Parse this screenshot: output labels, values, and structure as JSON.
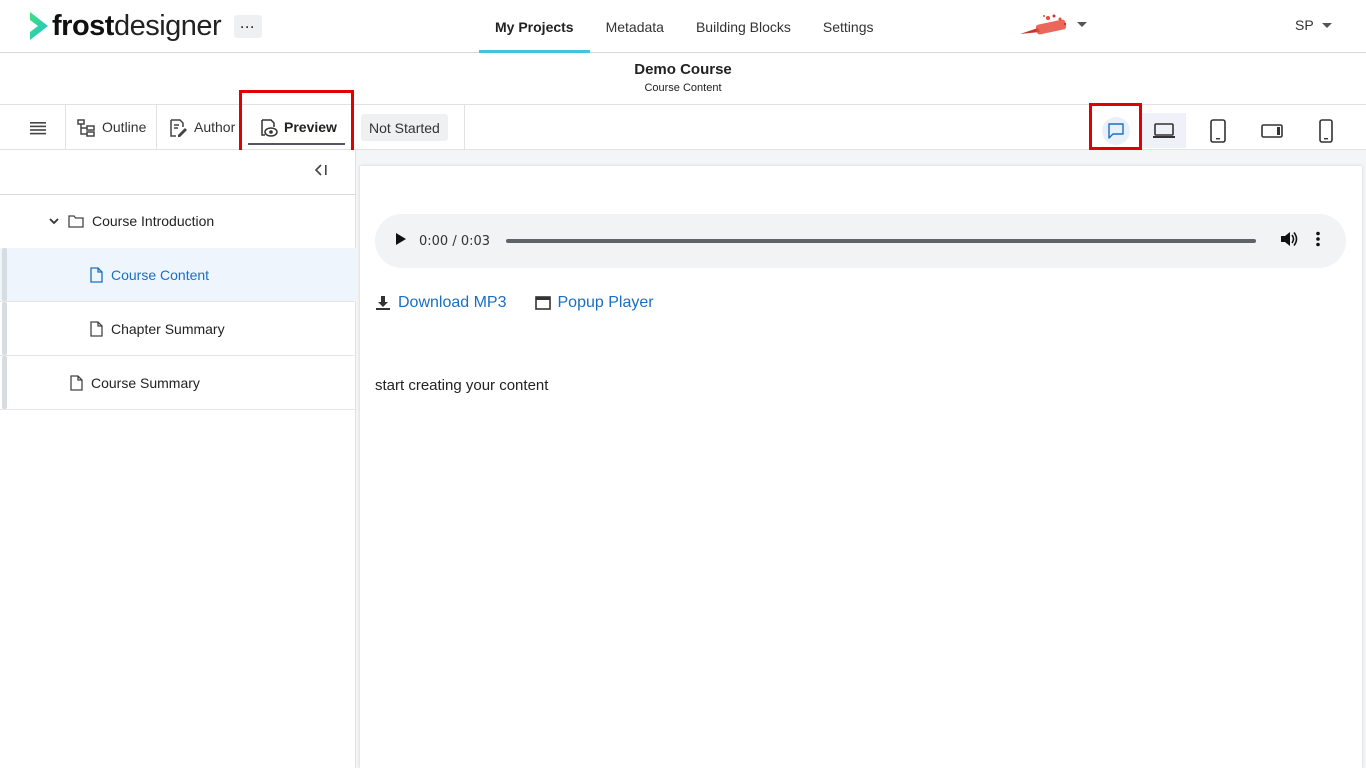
{
  "app": {
    "logo_bold": "frost",
    "logo_light": "designer"
  },
  "header": {
    "more_label": "···",
    "nav": [
      {
        "label": "My Projects",
        "active": true
      },
      {
        "label": "Metadata"
      },
      {
        "label": "Building Blocks"
      },
      {
        "label": "Settings"
      }
    ],
    "user_initials": "SP"
  },
  "course": {
    "title": "Demo Course",
    "subtitle": "Course Content"
  },
  "toolbar": {
    "tabs": {
      "outline": "Outline",
      "author": "Author",
      "preview": "Preview"
    },
    "status": "Not Started"
  },
  "sidebar": {
    "items": [
      {
        "label": "Course Introduction",
        "type": "folder"
      },
      {
        "label": "Course Content",
        "type": "page",
        "selected": true
      },
      {
        "label": "Chapter Summary",
        "type": "page"
      },
      {
        "label": "Course Summary",
        "type": "page"
      }
    ]
  },
  "content": {
    "audio": {
      "time": "0:00 / 0:03"
    },
    "links": {
      "download": "Download MP3",
      "popup": "Popup Player"
    },
    "body": "start creating your content"
  },
  "colors": {
    "accent": "#3ec6e0",
    "link": "#1a6fc4",
    "highlight": "#e00000",
    "logo_green": "#21d07a"
  }
}
